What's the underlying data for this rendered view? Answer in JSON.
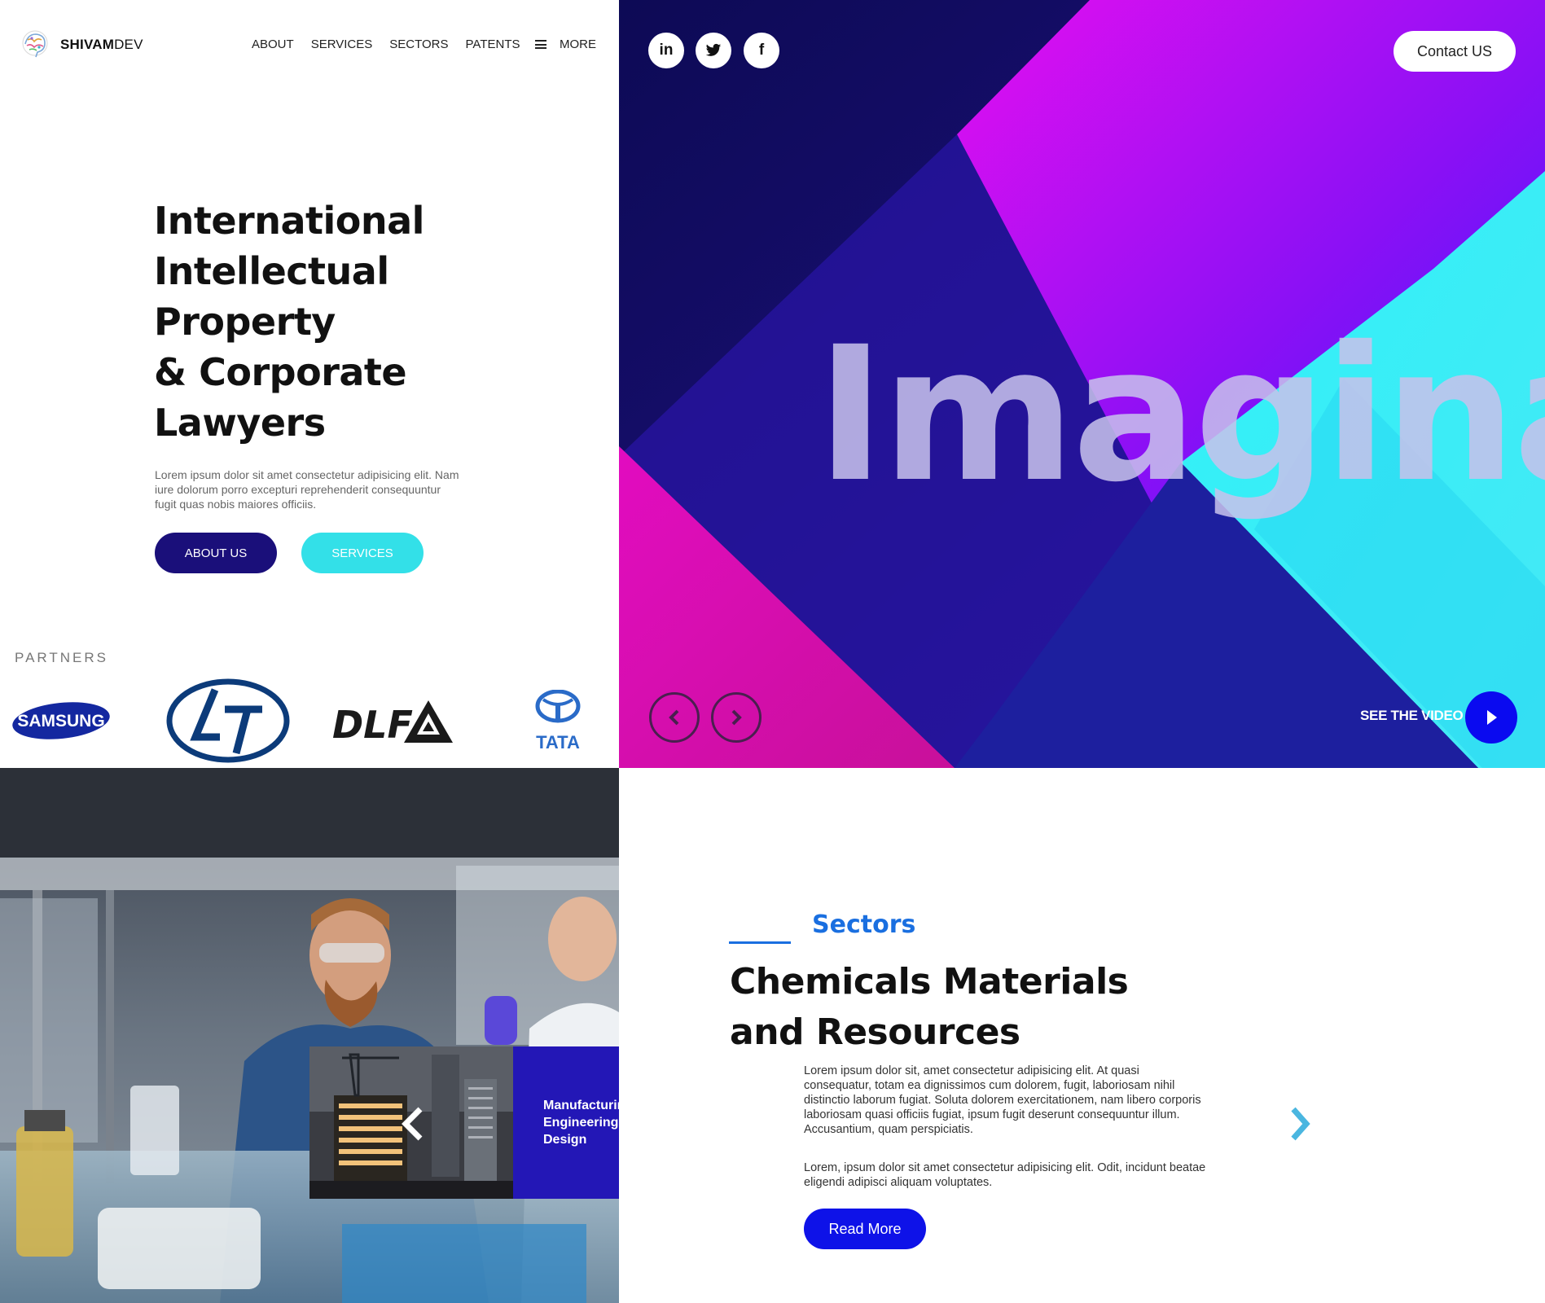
{
  "brand": {
    "name_bold": "SHIVAM",
    "name_thin": "DEV"
  },
  "nav": {
    "items": [
      "ABOUT",
      "SERVICES",
      "SECTORS",
      "PATENTS"
    ],
    "more_label": "MORE"
  },
  "hero": {
    "title_lines": [
      "International",
      "Intellectual",
      "Property",
      "& Corporate",
      "Lawyers"
    ],
    "description": "Lorem ipsum dolor sit amet consectetur adipisicing elit. Nam iure dolorum porro excepturi reprehenderit consequuntur fugit quas nobis maiores officiis.",
    "about_button": "ABOUT US",
    "services_button": "SERVICES"
  },
  "partners": {
    "label": "PARTNERS",
    "logos": [
      "SAMSUNG",
      "L&T",
      "DLF",
      "TATA"
    ]
  },
  "banner": {
    "social": [
      "in",
      "twitter",
      "f"
    ],
    "contact_button": "Contact US",
    "big_word": "Imagination",
    "see_video": "SEE THE VIDEO",
    "colors": {
      "dark": "#0c0a52",
      "magenta": "#e00cc0",
      "purple": "#8a10f5",
      "cyan": "#2ff2f8",
      "play": "#0a0af0"
    }
  },
  "slide": {
    "text": "Manufacturing Engineering & Industrial Design"
  },
  "sectors": {
    "label": "Sectors",
    "title_lines": [
      "Chemicals Materials",
      "and Resources"
    ],
    "paragraph_1": "Lorem ipsum dolor sit, amet consectetur adipisicing elit. At quasi consequatur, totam ea dignissimos cum dolorem, fugit, laboriosam nihil distinctio laborum fugiat. Soluta dolorem exercitationem, nam libero corporis laboriosam quasi officiis fugiat, ipsum fugit deserunt consequuntur illum. Accusantium, quam perspiciatis.",
    "paragraph_2": "Lorem, ipsum dolor sit amet consectetur adipisicing elit. Odit, incidunt beatae eligendi adipisci aliquam voluptates.",
    "read_more": "Read More",
    "accent": "#1a6fe0"
  }
}
